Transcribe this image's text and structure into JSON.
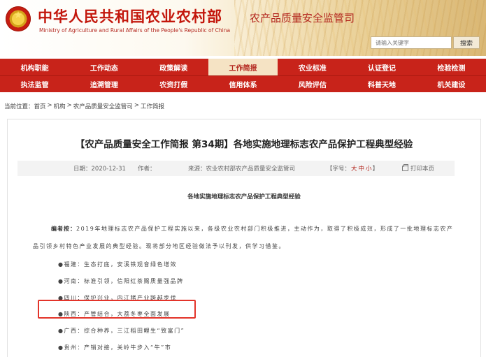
{
  "header": {
    "site_title": "中华人民共和国农业农村部",
    "site_subtitle": "Ministry of Agriculture and Rural Affairs of the People's Republic of China",
    "section_title": "农产品质量安全监管司",
    "search_placeholder": "请输入关键字",
    "search_button": "搜索"
  },
  "nav": {
    "row1": [
      "机构职能",
      "工作动态",
      "政策解读",
      "工作简报",
      "农业标准",
      "认证登记",
      "检验检测"
    ],
    "row2": [
      "执法监管",
      "追溯管理",
      "农资打假",
      "信用体系",
      "风险评估",
      "科普天地",
      "机关建设"
    ],
    "active": "工作简报"
  },
  "breadcrumb": {
    "prefix": "当前位置：",
    "items": [
      "首页",
      "机构",
      "农产品质量安全监管司",
      "工作简报"
    ],
    "separator": ">"
  },
  "article": {
    "title": "【农产品质量安全工作简报 第34期】各地实施地理标志农产品保护工程典型经验",
    "date": "日期：2020-12-31",
    "author": "作者：",
    "source": "来源：农业农村部农产品质量安全监管司",
    "font_label_prefix": "【字号：",
    "font_sizes": [
      "大",
      "中",
      "小"
    ],
    "font_label_suffix": "】",
    "print": "打印本页",
    "heading": "各地实施地理标志农产品保护工程典型经验",
    "editor_label": "编者按：",
    "editor_text_1": "2019年地理标志农产品保护工程实施以来，各级农业农村部门积极推进，主动作为，取得了积极成效，形成了一批地理标志农产",
    "editor_text_2": "品引领乡村特色产业发展的典型经验。现将部分地区经验做法予以刊发，供学习借鉴。",
    "items": [
      "●福建：生态打底，安溪铁观音绿色增效",
      "●河南：标准引领，信阳红茶赐质量强品牌",
      "●四川：保护兴业，内江猪产业跨越步伐",
      "●陕西：产管结合，大荔冬枣全面发展",
      "●广西：综合种养，三江稻田鲤生“致富门”",
      "●贵州：产销对接，关岭牛步入“牛”市"
    ]
  }
}
